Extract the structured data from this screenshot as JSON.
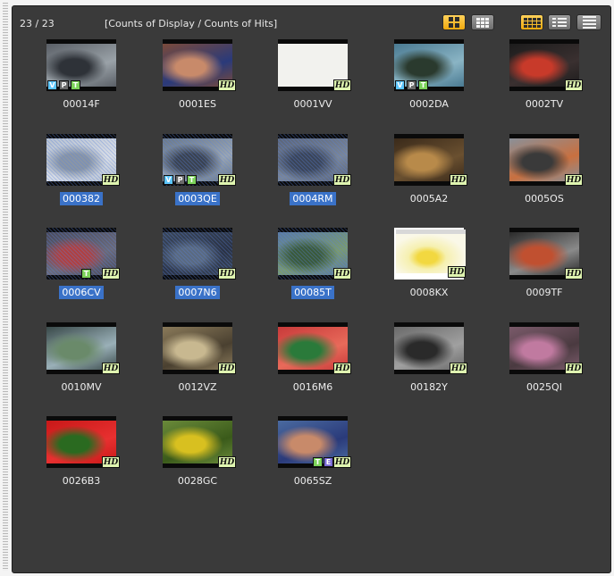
{
  "header": {
    "count": "23 / 23",
    "label": "[Counts of Display / Counts of Hits]"
  },
  "toolbar": {
    "buttons": [
      {
        "name": "large-thumbnail-view-button",
        "icon": "grid-4-icon",
        "state": "active"
      },
      {
        "name": "small-thumbnail-view-button",
        "icon": "grid-9-icon",
        "state": "inactive"
      },
      {
        "name": "thumbnail-view-button",
        "icon": "grid-12-icon",
        "state": "active"
      },
      {
        "name": "detail-view-button",
        "icon": "detail-list-icon",
        "state": "inactive"
      },
      {
        "name": "list-view-button",
        "icon": "list-icon",
        "state": "inactive"
      }
    ]
  },
  "clips": [
    {
      "id": "00014F",
      "selected": false,
      "badges": [
        "V",
        "P",
        "T"
      ],
      "hd": false
    },
    {
      "id": "0001ES",
      "selected": false,
      "badges": [],
      "hd": true
    },
    {
      "id": "0001VV",
      "selected": false,
      "badges": [],
      "hd": true
    },
    {
      "id": "0002DA",
      "selected": false,
      "badges": [
        "V",
        "P",
        "T"
      ],
      "hd": false
    },
    {
      "id": "0002TV",
      "selected": false,
      "badges": [],
      "hd": true
    },
    {
      "id": "000382",
      "selected": true,
      "badges": [],
      "hd": true
    },
    {
      "id": "0003QE",
      "selected": true,
      "badges": [
        "V",
        "P",
        "T"
      ],
      "hd": true
    },
    {
      "id": "0004RM",
      "selected": true,
      "badges": [],
      "hd": true
    },
    {
      "id": "0005A2",
      "selected": false,
      "badges": [],
      "hd": true
    },
    {
      "id": "0005OS",
      "selected": false,
      "badges": [],
      "hd": true
    },
    {
      "id": "0006CV",
      "selected": true,
      "badges": [
        "T"
      ],
      "hd": true
    },
    {
      "id": "0007N6",
      "selected": true,
      "badges": [],
      "hd": true
    },
    {
      "id": "00085T",
      "selected": true,
      "badges": [],
      "hd": true
    },
    {
      "id": "0008KX",
      "selected": false,
      "badges": [],
      "hd": true
    },
    {
      "id": "0009TF",
      "selected": false,
      "badges": [],
      "hd": true
    },
    {
      "id": "0010MV",
      "selected": false,
      "badges": [],
      "hd": true
    },
    {
      "id": "0012VZ",
      "selected": false,
      "badges": [],
      "hd": true
    },
    {
      "id": "0016M6",
      "selected": false,
      "badges": [],
      "hd": true
    },
    {
      "id": "00182Y",
      "selected": false,
      "badges": [],
      "hd": true
    },
    {
      "id": "0025QI",
      "selected": false,
      "badges": [],
      "hd": true
    },
    {
      "id": "0026B3",
      "selected": false,
      "badges": [],
      "hd": true
    },
    {
      "id": "0028GC",
      "selected": false,
      "badges": [],
      "hd": true
    },
    {
      "id": "0065SZ",
      "selected": false,
      "badges": [
        "T",
        "E"
      ],
      "hd": true
    }
  ],
  "badge_labels": {
    "hd": "HD"
  },
  "colors": {
    "panel_bg": "#3a3a3a",
    "selection": "#3a72c8",
    "active_button": "#f0a90e",
    "hd_badge": "#dff5b0"
  }
}
